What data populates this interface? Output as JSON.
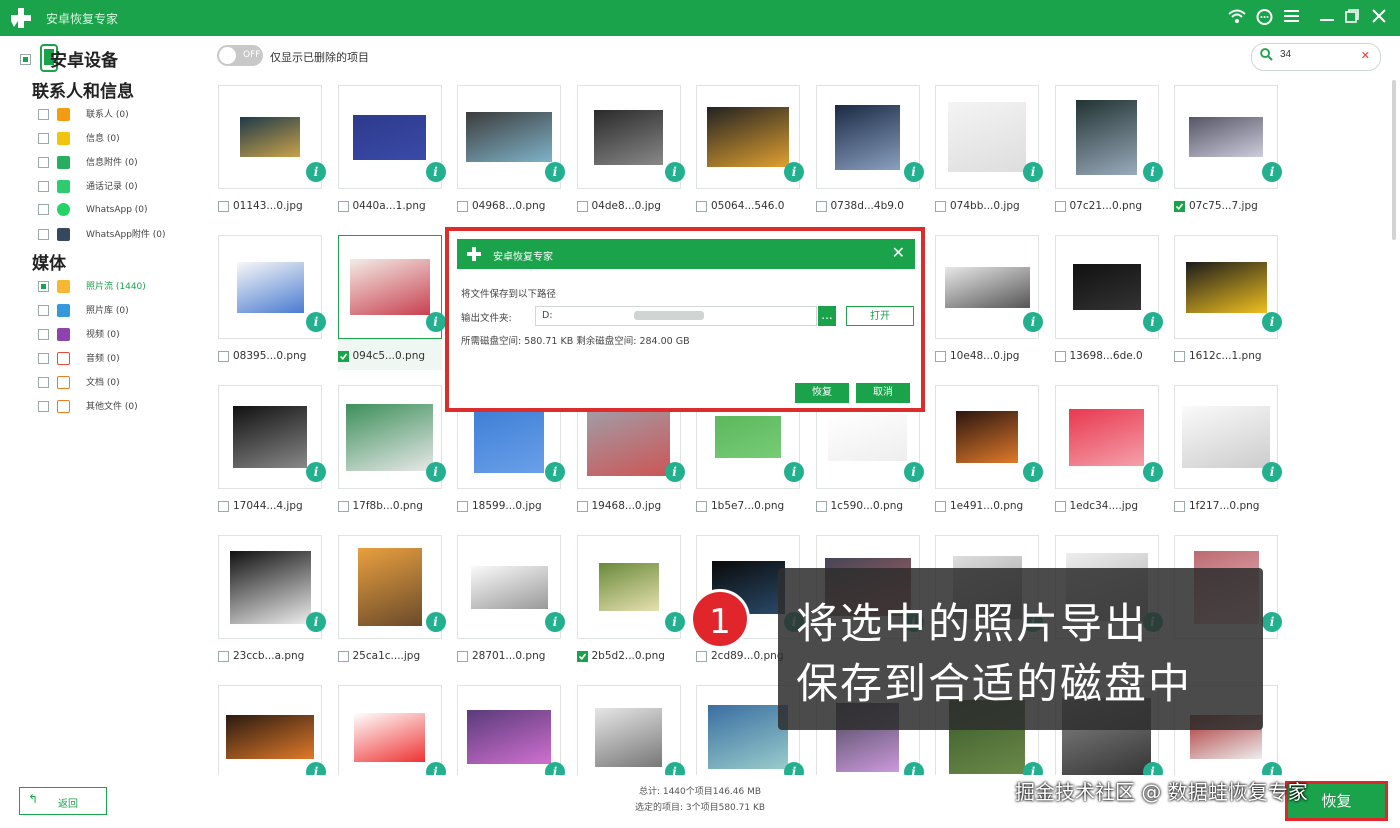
{
  "app": {
    "title": "安卓恢复专家",
    "brand_color": "#1aa34a",
    "window_icons": [
      "wifi-icon",
      "chat-icon",
      "menu-icon",
      "minimize-icon",
      "restore-icon",
      "close-icon"
    ]
  },
  "sidebar": {
    "device_label": "安卓设备",
    "sections": [
      {
        "title": "联系人和信息",
        "items": [
          {
            "label": "联系人 (0)",
            "icon": "contacts-icon",
            "color": "#f39c12"
          },
          {
            "label": "信息 (0)",
            "icon": "message-icon",
            "color": "#f1c40f"
          },
          {
            "label": "信息附件 (0)",
            "icon": "attachment-icon",
            "color": "#27ae60"
          },
          {
            "label": "通话记录 (0)",
            "icon": "call-log-icon",
            "color": "#2ecc71"
          },
          {
            "label": "WhatsApp (0)",
            "icon": "whatsapp-icon",
            "color": "#25d366"
          },
          {
            "label": "WhatsApp附件 (0)",
            "icon": "whatsapp-attachment-icon",
            "color": "#34495e"
          }
        ]
      },
      {
        "title": "媒体",
        "items": [
          {
            "label": "照片流 (1440)",
            "icon": "photo-stream-icon",
            "color": "#f7b733",
            "active": true
          },
          {
            "label": "照片库 (0)",
            "icon": "photo-library-icon",
            "color": "#3498db"
          },
          {
            "label": "视频 (0)",
            "icon": "video-icon",
            "color": "#8e44ad"
          },
          {
            "label": "音频 (0)",
            "icon": "audio-icon",
            "color": "#e74c3c"
          },
          {
            "label": "文档 (0)",
            "icon": "document-icon",
            "color": "#e67e22"
          },
          {
            "label": "其他文件 (0)",
            "icon": "other-files-icon",
            "color": "#e67e22"
          }
        ]
      }
    ],
    "back_label": "返回"
  },
  "toolbar": {
    "toggle_state": "OFF",
    "toggle_label": "仅显示已删除的项目",
    "search_value": "34"
  },
  "grid": {
    "rows": [
      [
        {
          "name": "01143...0.jpg",
          "checked": false
        },
        {
          "name": "0440a...1.png",
          "checked": false
        },
        {
          "name": "04968...0.png",
          "checked": false
        },
        {
          "name": "04de8...0.jpg",
          "checked": false
        },
        {
          "name": "05064...546.0",
          "checked": false
        },
        {
          "name": "0738d...4b9.0",
          "checked": false
        },
        {
          "name": "074bb...0.jpg",
          "checked": false
        },
        {
          "name": "07c21...0.png",
          "checked": false
        },
        {
          "name": "07c75...7.jpg",
          "checked": true
        }
      ],
      [
        {
          "name": "08395...0.png",
          "checked": false
        },
        {
          "name": "094c5...0.png",
          "checked": true,
          "selected": true
        },
        {
          "name": "",
          "checked": false
        },
        {
          "name": "",
          "checked": false
        },
        {
          "name": "",
          "checked": false
        },
        {
          "name": "",
          "checked": false
        },
        {
          "name": "10e48...0.jpg",
          "checked": false
        },
        {
          "name": "13698...6de.0",
          "checked": false
        },
        {
          "name": "1612c...1.png",
          "checked": false
        }
      ],
      [
        {
          "name": "17044...4.jpg",
          "checked": false
        },
        {
          "name": "17f8b...0.png",
          "checked": false
        },
        {
          "name": "18599...0.jpg",
          "checked": false
        },
        {
          "name": "19468...0.jpg",
          "checked": false
        },
        {
          "name": "1b5e7...0.png",
          "checked": false
        },
        {
          "name": "1c590...0.png",
          "checked": false
        },
        {
          "name": "1e491...0.png",
          "checked": false
        },
        {
          "name": "1edc34....jpg",
          "checked": false
        },
        {
          "name": "1f217...0.png",
          "checked": false
        }
      ],
      [
        {
          "name": "23ccb...a.png",
          "checked": false
        },
        {
          "name": "25ca1c....jpg",
          "checked": false
        },
        {
          "name": "28701...0.png",
          "checked": false
        },
        {
          "name": "2b5d2...0.png",
          "checked": true
        },
        {
          "name": "2cd89...0.png",
          "checked": false
        },
        {
          "name": "",
          "checked": false
        },
        {
          "name": "",
          "checked": false
        },
        {
          "name": "",
          "checked": false
        },
        {
          "name": "",
          "checked": false
        }
      ],
      [
        {
          "name": "",
          "checked": false
        },
        {
          "name": "",
          "checked": false
        },
        {
          "name": "",
          "checked": false
        },
        {
          "name": "",
          "checked": false
        },
        {
          "name": "",
          "checked": false
        },
        {
          "name": "",
          "checked": false
        },
        {
          "name": "",
          "checked": false
        },
        {
          "name": "",
          "checked": false
        },
        {
          "name": "",
          "checked": false
        }
      ]
    ]
  },
  "status": {
    "total": "总计: 1440个项目146.46 MB",
    "selected": "选定的项目: 3个项目580.71 KB"
  },
  "recover_button": "恢复",
  "dialog": {
    "title": "安卓恢复专家",
    "prompt": "将文件保存到以下路径",
    "folder_label": "输出文件夹:",
    "folder_value": "D:",
    "browse": "...",
    "open": "打开",
    "space_info": "所需磁盘空间: 580.71 KB 剩余磁盘空间: 284.00 GB",
    "ok": "恢复",
    "cancel": "取消"
  },
  "overlay": {
    "step": "1",
    "line1": "将选中的照片导出",
    "line2": "保存到合适的磁盘中"
  },
  "watermark": "掘金技术社区 @ 数据蛙恢复专家"
}
